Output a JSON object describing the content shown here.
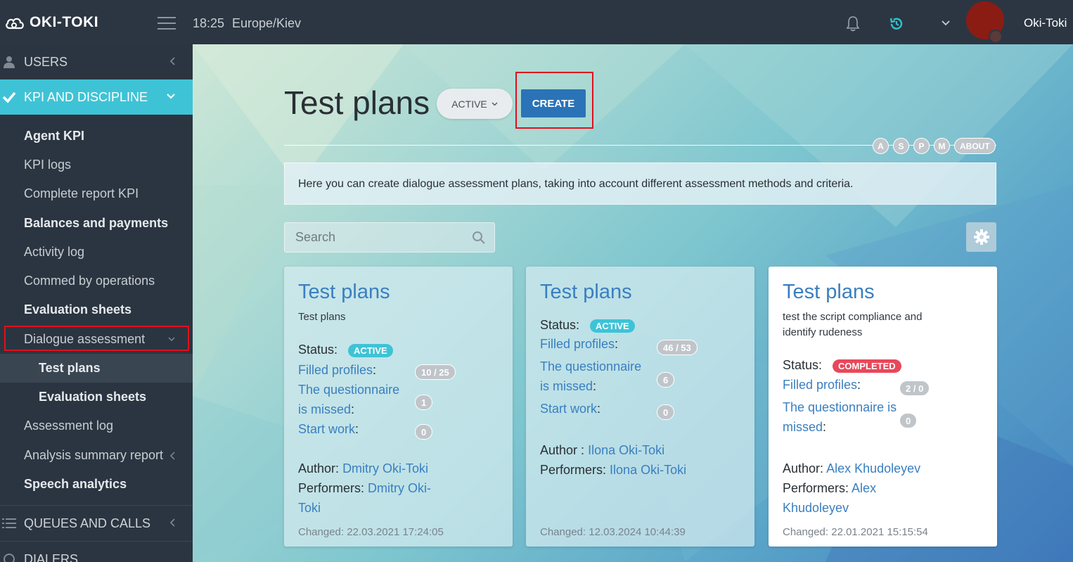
{
  "topbar": {
    "logo": "OKI-TOKI",
    "time": "18:25",
    "timezone": "Europe/Kiev",
    "user": "Oki-Toki"
  },
  "sidebar": {
    "users": "USERS",
    "kpi": "KPI AND DISCIPLINE",
    "items": [
      {
        "label": "Agent KPI",
        "bold": true
      },
      {
        "label": "KPI logs",
        "bold": false
      },
      {
        "label": "Complete report KPI",
        "bold": false
      },
      {
        "label": "Balances and payments",
        "bold": true
      },
      {
        "label": "Activity log",
        "bold": false
      },
      {
        "label": "Commed by operations",
        "bold": false
      },
      {
        "label": "Evaluation sheets",
        "bold": true
      }
    ],
    "dialogue": "Dialogue assessment",
    "sub_test_plans": "Test plans",
    "sub_eval_sheets": "Evaluation sheets",
    "assessment_log": "Assessment log",
    "analysis_report": "Analysis summary report",
    "speech": "Speech analytics",
    "queues": "QUEUES AND CALLS",
    "dialers": "DIALERS"
  },
  "main": {
    "title": "Test plans",
    "status_filter": "ACTIVE",
    "create": "CREATE",
    "letters": [
      "A",
      "S",
      "P",
      "M"
    ],
    "about": "ABOUT",
    "info": "Here you can create dialogue assessment plans, taking into account different assessment methods and criteria.",
    "search_placeholder": "Search"
  },
  "cards": [
    {
      "title": "Test plans",
      "desc": "Test plans",
      "status_label": "Status:",
      "status": "ACTIVE",
      "filled_label": "Filled profiles",
      "filled": "10 / 25",
      "missed_label_1": "The questionnaire",
      "missed_label_2": "is missed",
      "missed": "1",
      "start_label": "Start work",
      "start": "0",
      "author_label": "Author:",
      "author": "Dmitry Oki-Toki",
      "performers_label": "Performers:",
      "performers_1": "Dmitry Oki-",
      "performers_2": "Toki",
      "changed": "Changed: 22.03.2021 17:24:05"
    },
    {
      "title": "Test plans",
      "status_label": "Status:",
      "status": "ACTIVE",
      "filled_label": "Filled profiles",
      "filled": "46 / 53",
      "missed_label_1": "The questionnaire",
      "missed_label_2": "is missed",
      "missed": "6",
      "start_label": "Start work",
      "start": "0",
      "author_label": "Author :",
      "author": "Ilona Oki-Toki",
      "performers_label": "Performers:",
      "performers": "Ilona Oki-Toki",
      "changed": "Changed: 12.03.2024 10:44:39"
    },
    {
      "title": "Test plans",
      "desc_1": "test the script compliance and",
      "desc_2": "identify rudeness",
      "status_label": "Status:",
      "status": "COMPLETED",
      "filled_label": "Filled profiles",
      "filled": "2 / 0",
      "missed_label_1": "The questionnaire is",
      "missed_label_2": "missed",
      "missed": "0",
      "author_label": "Author:",
      "author": "Alex Khudoleyev",
      "performers_label": "Performers:",
      "performers_1": "Alex",
      "performers_2": "Khudoleyev",
      "changed": "Changed: 22.01.2021 15:15:54"
    }
  ]
}
